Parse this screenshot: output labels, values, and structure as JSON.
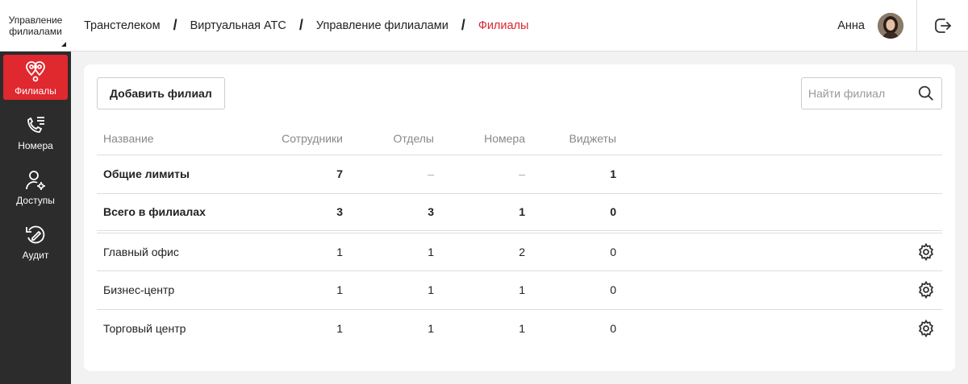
{
  "sidebar": {
    "brand": "Управление филиалами",
    "items": [
      {
        "label": "Филиалы",
        "icon": "map-pins-icon",
        "active": true
      },
      {
        "label": "Номера",
        "icon": "phone-list-icon",
        "active": false
      },
      {
        "label": "Доступы",
        "icon": "user-gear-icon",
        "active": false
      },
      {
        "label": "Аудит",
        "icon": "audit-icon",
        "active": false
      }
    ]
  },
  "header": {
    "breadcrumbs": [
      "Транстелеком",
      "Виртуальная АТС",
      "Управление филиалами",
      "Филиалы"
    ],
    "user_name": "Анна"
  },
  "toolbar": {
    "add_label": "Добавить филиал",
    "search_placeholder": "Найти филиал"
  },
  "table": {
    "columns": [
      "Название",
      "Сотрудники",
      "Отделы",
      "Номера",
      "Виджеты"
    ],
    "summary": [
      {
        "name": "Общие лимиты",
        "employees": "7",
        "departments": "–",
        "numbers": "–",
        "widgets": "1"
      },
      {
        "name": "Всего в филиалах",
        "employees": "3",
        "departments": "3",
        "numbers": "1",
        "widgets": "0"
      }
    ],
    "rows": [
      {
        "name": "Главный офис",
        "employees": "1",
        "departments": "1",
        "numbers": "2",
        "widgets": "0"
      },
      {
        "name": "Бизнес-центр",
        "employees": "1",
        "departments": "1",
        "numbers": "1",
        "widgets": "0"
      },
      {
        "name": "Торговый центр",
        "employees": "1",
        "departments": "1",
        "numbers": "1",
        "widgets": "0"
      }
    ]
  },
  "colors": {
    "accent": "#e0282f",
    "sidebar": "#2c2c2c",
    "current_crumb": "#d9262f"
  }
}
